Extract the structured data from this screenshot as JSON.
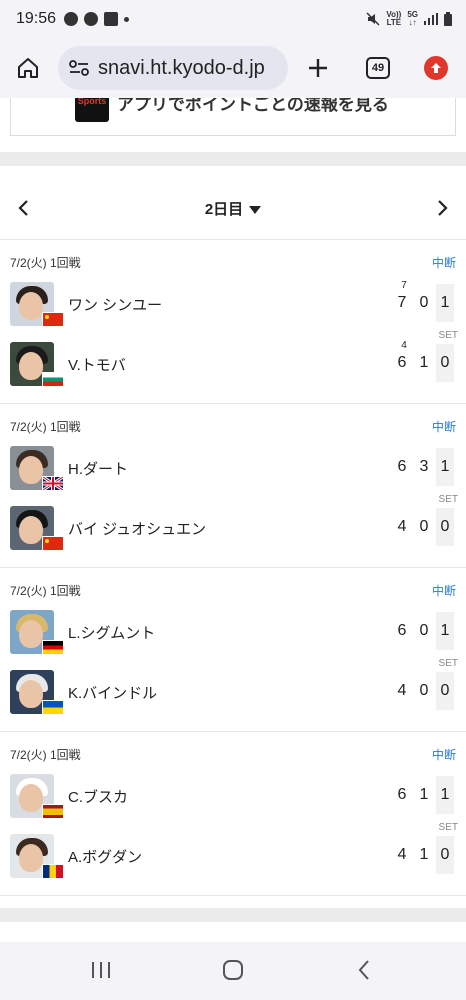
{
  "status_bar": {
    "time": "19:56",
    "net1": "Vo))\nLTE",
    "net2": "5G\n↓↑"
  },
  "browser": {
    "url": "snavi.ht.kyodo-d.jp",
    "tab_count": "49"
  },
  "banner": {
    "logo_text": "Sports",
    "text": "アプリでポイントごとの速報を見る"
  },
  "day_nav": {
    "label": "2日目"
  },
  "matches": [
    {
      "round": "7/2(火) 1回戦",
      "status": "中断",
      "set_label": "SET",
      "players": [
        {
          "name": "ワン シンユー",
          "tb": "7",
          "g1": "7",
          "g2": "0",
          "sets": "1"
        },
        {
          "name": "V.トモバ",
          "tb": "4",
          "g1": "6",
          "g2": "1",
          "sets": "0"
        }
      ]
    },
    {
      "round": "7/2(火) 1回戦",
      "status": "中断",
      "set_label": "SET",
      "players": [
        {
          "name": "H.ダート",
          "tb": "",
          "g1": "6",
          "g2": "3",
          "sets": "1"
        },
        {
          "name": "バイ ジュオシュエン",
          "tb": "",
          "g1": "4",
          "g2": "0",
          "sets": "0"
        }
      ]
    },
    {
      "round": "7/2(火) 1回戦",
      "status": "中断",
      "set_label": "SET",
      "players": [
        {
          "name": "L.シグムント",
          "tb": "",
          "g1": "6",
          "g2": "0",
          "sets": "1"
        },
        {
          "name": "K.バインドル",
          "tb": "",
          "g1": "4",
          "g2": "0",
          "sets": "0"
        }
      ]
    },
    {
      "round": "7/2(火) 1回戦",
      "status": "中断",
      "set_label": "SET",
      "players": [
        {
          "name": "C.ブスカ",
          "tb": "",
          "g1": "6",
          "g2": "1",
          "sets": "1"
        },
        {
          "name": "A.ボグダン",
          "tb": "",
          "g1": "4",
          "g2": "1",
          "sets": "0"
        }
      ]
    }
  ],
  "colors": {
    "accent_status": "#2a7bd3",
    "update_button": "#e0362c"
  }
}
